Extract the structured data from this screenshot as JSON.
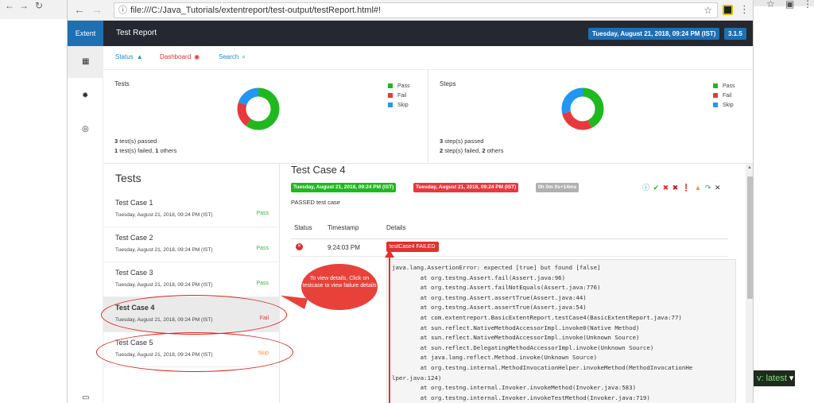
{
  "browser": {
    "url": "file:///C:/Java_Tutorials/extentreport/test-output/testReport.html#!",
    "info_icon": "info-circle-icon",
    "bookmark_icon": "star-icon"
  },
  "outer": {
    "version_label": "v: latest"
  },
  "header": {
    "brand": "Extent",
    "title": "Test Report",
    "date": "Tuesday, August 21, 2018, 09:24 PM (IST)",
    "version": "3.1.5"
  },
  "tabs": [
    {
      "label": "Status",
      "color": "#1f8ad6",
      "icon": "warning-icon"
    },
    {
      "label": "Dashboard",
      "color": "#e0322f",
      "icon": "dashboard-icon"
    },
    {
      "label": "Search",
      "color": "#1f8ad6",
      "icon": "search-icon"
    }
  ],
  "summary": {
    "tests": {
      "title": "Tests",
      "legend": [
        "Pass",
        "Fail",
        "Skip"
      ],
      "passed_count": "3",
      "passed_label": " test(s) passed",
      "failed_count": "1",
      "failed_label": " test(s) failed, ",
      "others_count": "1",
      "others_label": " others",
      "donut": {
        "pass": 3,
        "fail": 1,
        "skip": 1
      }
    },
    "steps": {
      "title": "Steps",
      "legend": [
        "Pass",
        "Fail",
        "Skip"
      ],
      "passed_count": "3",
      "passed_label": " step(s) passed",
      "failed_count": "2",
      "failed_label": " step(s) failed, ",
      "others_count": "2",
      "others_label": " others",
      "donut": {
        "pass": 3,
        "fail": 2,
        "skip": 2
      }
    },
    "colors": {
      "pass": "#1fb81f",
      "fail": "#e8383d",
      "skip": "#2196f3"
    }
  },
  "tests_panel": {
    "heading": "Tests",
    "items": [
      {
        "name": "Test Case 1",
        "date": "Tuesday, August 21, 2018, 09:24 PM (IST)",
        "status": "Pass",
        "status_color": "#3cb83c"
      },
      {
        "name": "Test Case 2",
        "date": "Tuesday, August 21, 2018, 09:24 PM (IST)",
        "status": "Pass",
        "status_color": "#3cb83c"
      },
      {
        "name": "Test Case 3",
        "date": "Tuesday, August 21, 2018, 09:24 PM (IST)",
        "status": "Pass",
        "status_color": "#3cb83c"
      },
      {
        "name": "Test Case 4",
        "date": "Tuesday, August 21, 2018, 09:24 PM (IST)",
        "status": "Fail",
        "status_color": "#e0322f"
      },
      {
        "name": "Test Case 5",
        "date": "Tuesday, August 21, 2018, 09:24 PM (IST)",
        "status": "Skip",
        "status_color": "#f0963c"
      }
    ]
  },
  "detail": {
    "title": "Test Case 4",
    "start_badge": "Tuesday, August 21, 2018, 09:24 PM (IST)",
    "end_badge": "Tuesday, August 21, 2018, 09:24 PM (IST)",
    "duration_badge": "0h 0m 0s+14ms",
    "description": "PASSED test case",
    "columns": [
      "Status",
      "Timestamp",
      "Details"
    ],
    "log": {
      "timestamp": "9:24:03 PM",
      "label": "testCase4 FAILED",
      "stacktrace": "java.lang.AssertionError: expected [true] but found [false]\n\tat org.testng.Assert.fail(Assert.java:96)\n\tat org.testng.Assert.failNotEquals(Assert.java:776)\n\tat org.testng.Assert.assertTrue(Assert.java:44)\n\tat org.testng.Assert.assertTrue(Assert.java:54)\n\tat com.extentreport.BasicExtentReport.testCase4(BasicExtentReport.java:77)\n\tat sun.reflect.NativeMethodAccessorImpl.invoke0(Native Method)\n\tat sun.reflect.NativeMethodAccessorImpl.invoke(Unknown Source)\n\tat sun.reflect.DelegatingMethodAccessorImpl.invoke(Unknown Source)\n\tat java.lang.reflect.Method.invoke(Unknown Source)\n\tat org.testng.internal.MethodInvocationHelper.invokeMethod(MethodInvocationHe\nlper.java:124)\n\tat org.testng.internal.Invoker.invokeMethod(Invoker.java:583)\n\tat org.testng.internal.Invoker.invokeTestMethod(Invoker.java:719)"
    },
    "filter_icons": [
      "info-icon",
      "pass-icon",
      "fail-icon",
      "fatal-icon",
      "error-icon",
      "warning-icon",
      "skip-icon",
      "clear-icon"
    ]
  },
  "annotation": {
    "text": "To view details, Click on testcase to view failure details"
  }
}
